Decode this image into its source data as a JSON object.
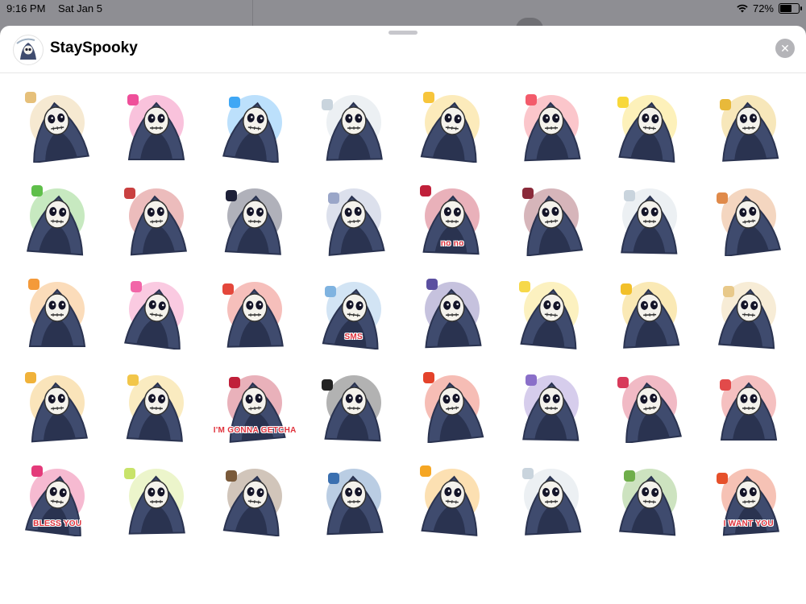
{
  "status_bar": {
    "time": "9:16 PM",
    "date": "Sat Jan 5",
    "battery_text": "72%",
    "battery_level": 0.72
  },
  "sheet": {
    "app_name": "StaySpooky",
    "app_icon": "reaper-sticker-icon",
    "close_icon": "close-icon"
  },
  "colors": {
    "robe": "#3f4b6e",
    "robe_shadow": "#2a3350",
    "skull": "#f4f2ec",
    "accent_red": "#e0323c"
  },
  "stickers": [
    {
      "icon": "reaper-scythe-laughing-icon",
      "label": "",
      "accent": "#e6c07a"
    },
    {
      "icon": "reaper-blowing-kisses-icon",
      "label": "",
      "accent": "#ef4f9a"
    },
    {
      "icon": "reaper-blue-flames-icon",
      "label": "",
      "accent": "#3fa7f5"
    },
    {
      "icon": "reaper-scythe-shrug-icon",
      "label": "",
      "accent": "#c9d4dd"
    },
    {
      "icon": "reaper-party-ghost-icon",
      "label": "",
      "accent": "#f7c53b"
    },
    {
      "icon": "reaper-balloons-icon",
      "label": "",
      "accent": "#f35b6b"
    },
    {
      "icon": "reaper-celebration-icon",
      "label": "",
      "accent": "#f8d83a"
    },
    {
      "icon": "reaper-trophy-icon",
      "label": "",
      "accent": "#e8b93a"
    },
    {
      "icon": "reaper-money-fans-icon",
      "label": "",
      "accent": "#5fbf4a"
    },
    {
      "icon": "reaper-smoking-icon",
      "label": "",
      "accent": "#c94040"
    },
    {
      "icon": "reaper-hooded-dark-icon",
      "label": "",
      "accent": "#1d2038"
    },
    {
      "icon": "reaper-facepalm-icon",
      "label": "",
      "accent": "#9aa6c8"
    },
    {
      "icon": "reaper-no-no-icon",
      "label": "no no",
      "accent": "#c0203a"
    },
    {
      "icon": "reaper-thinking-icon",
      "label": "",
      "accent": "#8a2a3a"
    },
    {
      "icon": "reaper-scythe-thinking-icon",
      "label": "",
      "accent": "#c9d4dd"
    },
    {
      "icon": "reaper-hourglass-icon",
      "label": "",
      "accent": "#e08a4a"
    },
    {
      "icon": "reaper-cat-hug-icon",
      "label": "",
      "accent": "#f49a3a"
    },
    {
      "icon": "reaper-old-man-hug-icon",
      "label": "",
      "accent": "#f266a8"
    },
    {
      "icon": "reaper-sombrero-icon",
      "label": "",
      "accent": "#e4473b"
    },
    {
      "icon": "reaper-sms-icon",
      "label": "SMS",
      "accent": "#7fb3e0"
    },
    {
      "icon": "reaper-window-night-icon",
      "label": "",
      "accent": "#5b4fa0"
    },
    {
      "icon": "reaper-make-love-icon",
      "label": "",
      "accent": "#f6d84a"
    },
    {
      "icon": "reaper-argh-icon",
      "label": "",
      "accent": "#f2c02a"
    },
    {
      "icon": "reaper-scroll-list-icon",
      "label": "",
      "accent": "#e8c98a"
    },
    {
      "icon": "reaper-trumpet-icon",
      "label": "",
      "accent": "#f0b23a"
    },
    {
      "icon": "reaper-okay-icon",
      "label": "",
      "accent": "#f2c64a"
    },
    {
      "icon": "reaper-gonna-getcha-icon",
      "label": "I'M GONNA GETCHA",
      "accent": "#c0203a"
    },
    {
      "icon": "reaper-pirate-flag-icon",
      "label": "",
      "accent": "#222222"
    },
    {
      "icon": "reaper-guitar-rock-icon",
      "label": "",
      "accent": "#e4432b"
    },
    {
      "icon": "reaper-knock-icon",
      "label": "",
      "accent": "#8a6fc9"
    },
    {
      "icon": "reaper-tell-me-your-name-icon",
      "label": "",
      "accent": "#d83a5a"
    },
    {
      "icon": "reaper-potion-icon",
      "label": "",
      "accent": "#e24a4a"
    },
    {
      "icon": "reaper-bless-you-icon",
      "label": "BLESS YOU",
      "accent": "#e43a7a"
    },
    {
      "icon": "reaper-wizard-icon",
      "label": "",
      "accent": "#c8e36a"
    },
    {
      "icon": "reaper-sleepy-hourglass-icon",
      "label": "",
      "accent": "#7a5a3a"
    },
    {
      "icon": "reaper-moon-cookies-icon",
      "label": "",
      "accent": "#3a6fb0"
    },
    {
      "icon": "reaper-flaming-skull-icon",
      "label": "",
      "accent": "#f5a623"
    },
    {
      "icon": "reaper-scythe-pout-icon",
      "label": "",
      "accent": "#c9d4dd"
    },
    {
      "icon": "reaper-rip-grave-icon",
      "label": "",
      "accent": "#6fae4a"
    },
    {
      "icon": "reaper-i-want-you-icon",
      "label": "I WANT YOU",
      "accent": "#e6502a"
    }
  ]
}
